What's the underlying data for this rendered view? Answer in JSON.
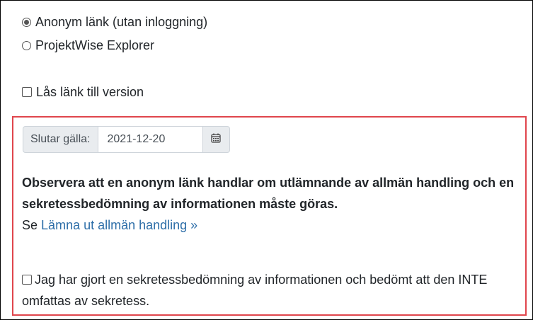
{
  "link_type": {
    "options": [
      {
        "label": "Anonym länk (utan inloggning)",
        "selected": true
      },
      {
        "label": "ProjektWise Explorer",
        "selected": false
      }
    ]
  },
  "lock_version": {
    "label": "Lås länk till version",
    "checked": false
  },
  "expiry": {
    "prefix_label": "Slutar gälla:",
    "value": "2021-12-20",
    "calendar_icon": "calendar-icon"
  },
  "warning": {
    "bold_text": "Observera att en anonym länk handlar om utlämnande av allmän handling och en sekretessbedömning av informationen måste göras.",
    "see_prefix": "Se",
    "link_text": "Lämna ut allmän handling »"
  },
  "confirmation": {
    "label": "Jag har gjort en sekretessbedömning av informationen och bedömt att den INTE omfattas av sekretess.",
    "checked": false
  },
  "colors": {
    "highlight_border": "#e0454c",
    "link": "#2d6ea8",
    "addon_bg": "#e9ecef"
  }
}
